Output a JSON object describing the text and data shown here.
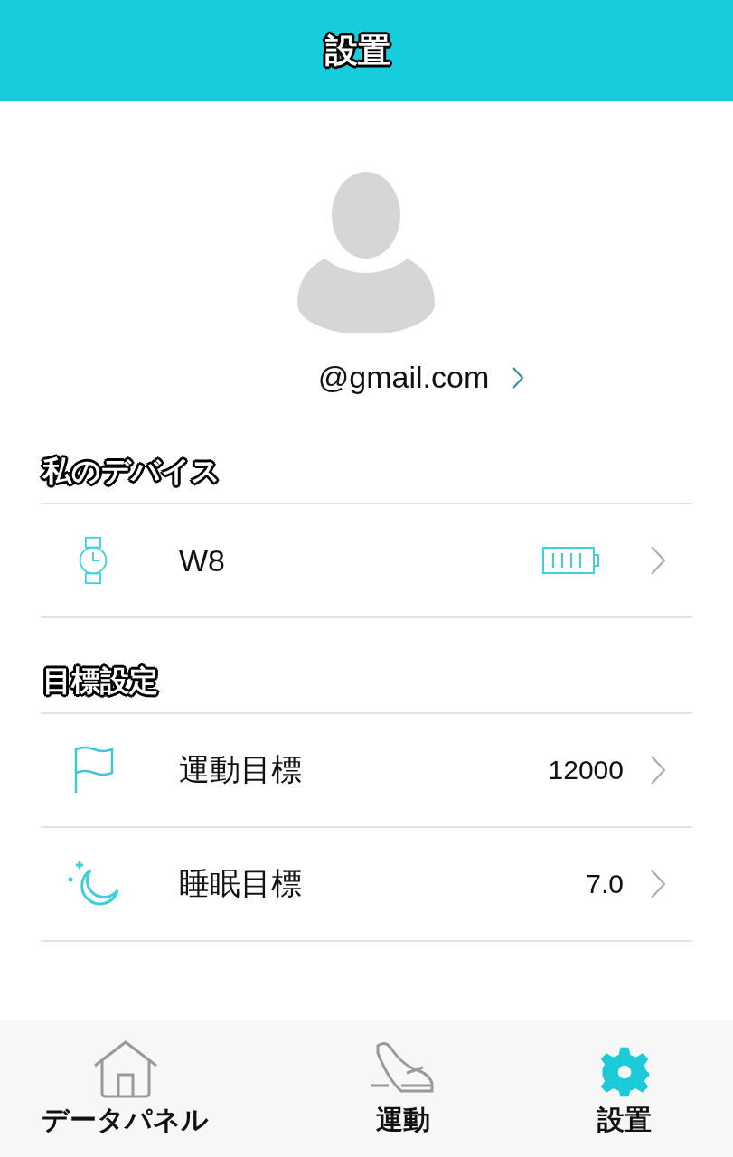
{
  "header": {
    "title": "設置"
  },
  "profile": {
    "email": "@gmail.com"
  },
  "sections": [
    {
      "title": "私のデバイス",
      "rows": [
        {
          "kind": "device",
          "label": "W8"
        }
      ]
    },
    {
      "title": "目標設定",
      "rows": [
        {
          "kind": "flag",
          "label": "運動目標",
          "value": "12000"
        },
        {
          "kind": "moon",
          "label": "睡眠目標",
          "value": "7.0"
        }
      ]
    }
  ],
  "tabs": [
    {
      "kind": "home",
      "label": "データパネル",
      "selected": false
    },
    {
      "kind": "shoe",
      "label": "運動",
      "selected": false
    },
    {
      "kind": "gear",
      "label": "設置",
      "selected": true
    }
  ]
}
